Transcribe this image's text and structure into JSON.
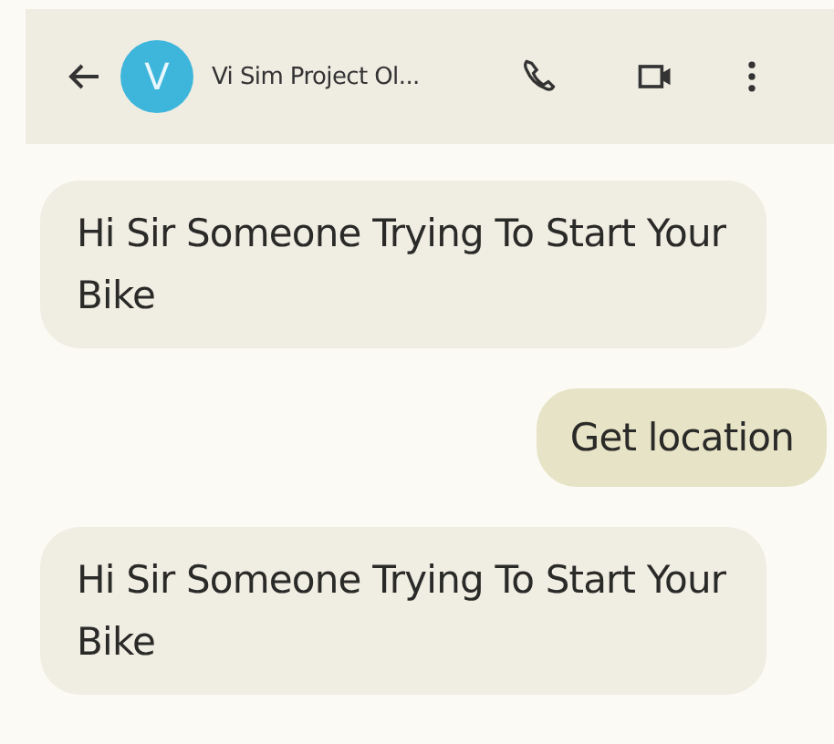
{
  "header": {
    "avatar_letter": "V",
    "title": "Vi Sim Project Ol..."
  },
  "messages": [
    {
      "kind": "received",
      "text": "Hi Sir Someone Trying To Start Your Bike"
    },
    {
      "kind": "sent",
      "text": "Get location"
    },
    {
      "kind": "received",
      "text": "Hi Sir Someone Trying To Start Your Bike"
    }
  ]
}
